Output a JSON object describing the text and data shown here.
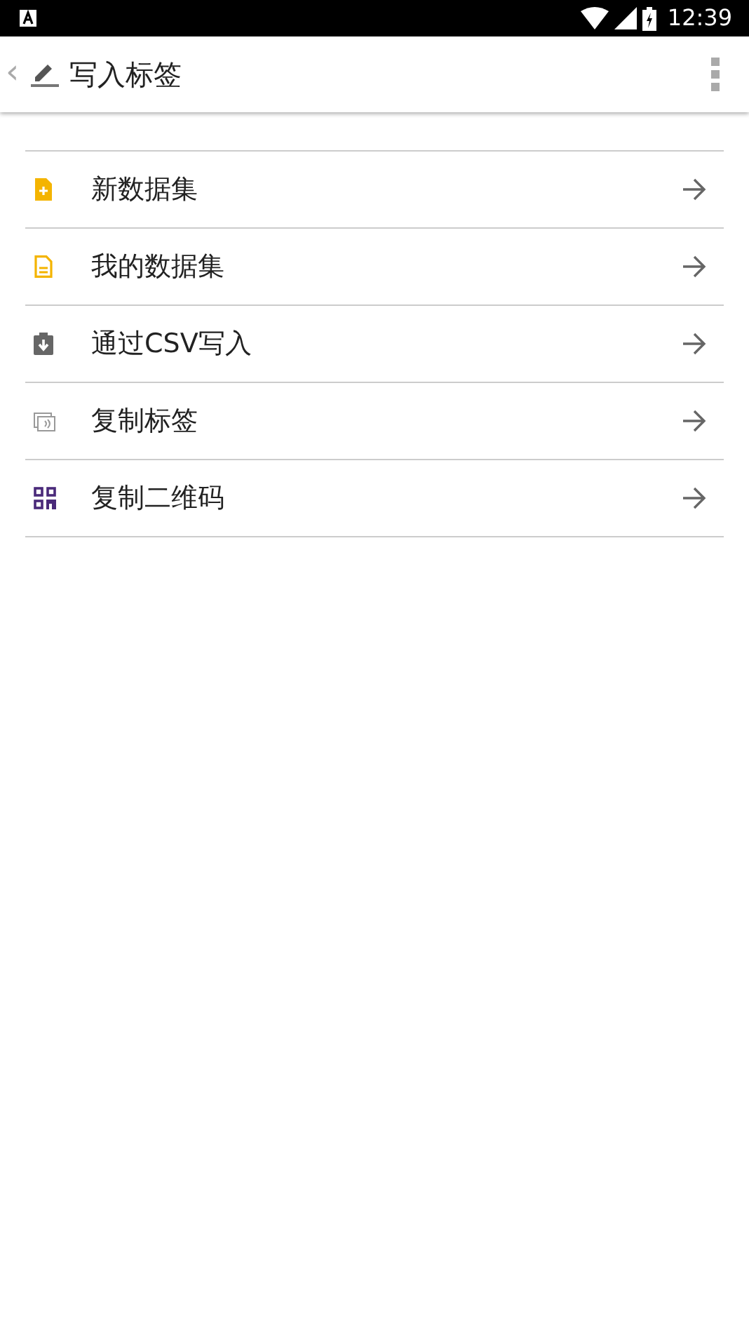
{
  "status_bar": {
    "time": "12:39"
  },
  "app_bar": {
    "back": "‹",
    "title": "写入标签"
  },
  "items": [
    {
      "kind": "new-file",
      "label": "新数据集"
    },
    {
      "kind": "file",
      "label": "我的数据集"
    },
    {
      "kind": "clipboard",
      "label": "通过CSV写入"
    },
    {
      "kind": "nfc-card",
      "label": "复制标签"
    },
    {
      "kind": "qr",
      "label": "复制二维码"
    }
  ]
}
